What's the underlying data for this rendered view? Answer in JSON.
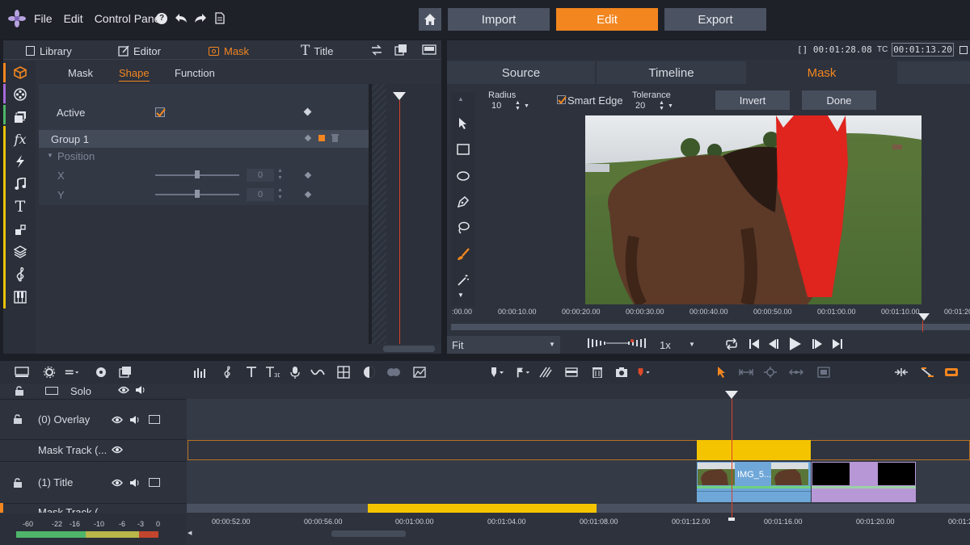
{
  "menu": {
    "file": "File",
    "edit": "Edit",
    "control_panel": "Control Panel"
  },
  "modes": {
    "import": "Import",
    "edit": "Edit",
    "export": "Export",
    "active": "Edit"
  },
  "left_tabs": {
    "library": "Library",
    "editor": "Editor",
    "mask": "Mask",
    "title": "Title"
  },
  "sub_tabs": {
    "mask": "Mask",
    "shape": "Shape",
    "function": "Function"
  },
  "properties": {
    "active_label": "Active",
    "group_label": "Group 1",
    "position_label": "Position",
    "x_label": "X",
    "y_label": "Y",
    "x_value": "0",
    "y_value": "0"
  },
  "timecodes": {
    "duration_prefix": "[]",
    "duration": "00:01:28.08",
    "tc_label": "TC",
    "tc": "00:01:13.20"
  },
  "preview_tabs": {
    "source": "Source",
    "timeline": "Timeline",
    "mask": "Mask"
  },
  "mask_tools": {
    "radius_label": "Radius",
    "radius_value": "10",
    "smart_edge_label": "Smart Edge",
    "tolerance_label": "Tolerance",
    "tolerance_value": "20",
    "invert": "Invert",
    "done": "Done"
  },
  "preview_ruler": [
    ":00.00",
    "00:00:10.00",
    "00:00:20.00",
    "00:00:30.00",
    "00:00:40.00",
    "00:00:50.00",
    "00:01:00.00",
    "00:01:10.00",
    "00:01:20"
  ],
  "playback": {
    "fit": "Fit",
    "speed": "1x"
  },
  "tracks": {
    "solo": "Solo",
    "overlay": "(0) Overlay",
    "mask_track_1": "Mask Track (...",
    "title": "(1) Title",
    "mask_track_2": "Mask Track (..."
  },
  "clips": {
    "clip_name": "IMG_5..."
  },
  "audio_meter": [
    "-60",
    "-22",
    "-16",
    "-10",
    "-6",
    "-3",
    "0"
  ],
  "bottom_ruler": [
    "00:00:52.00",
    "00:00:56.00",
    "00:01:00.00",
    "00:01:04.00",
    "00:01:08.00",
    "00:01:12.00",
    "00:01:16.00",
    "00:01:20.00",
    "00:01:2"
  ],
  "colors": {
    "accent": "#f3861f",
    "mask_red": "#e0241e",
    "clip_yellow": "#f5c400",
    "clip_blue": "#6ea7d8",
    "clip_purple": "#b897d6",
    "playhead": "#d9432b"
  }
}
